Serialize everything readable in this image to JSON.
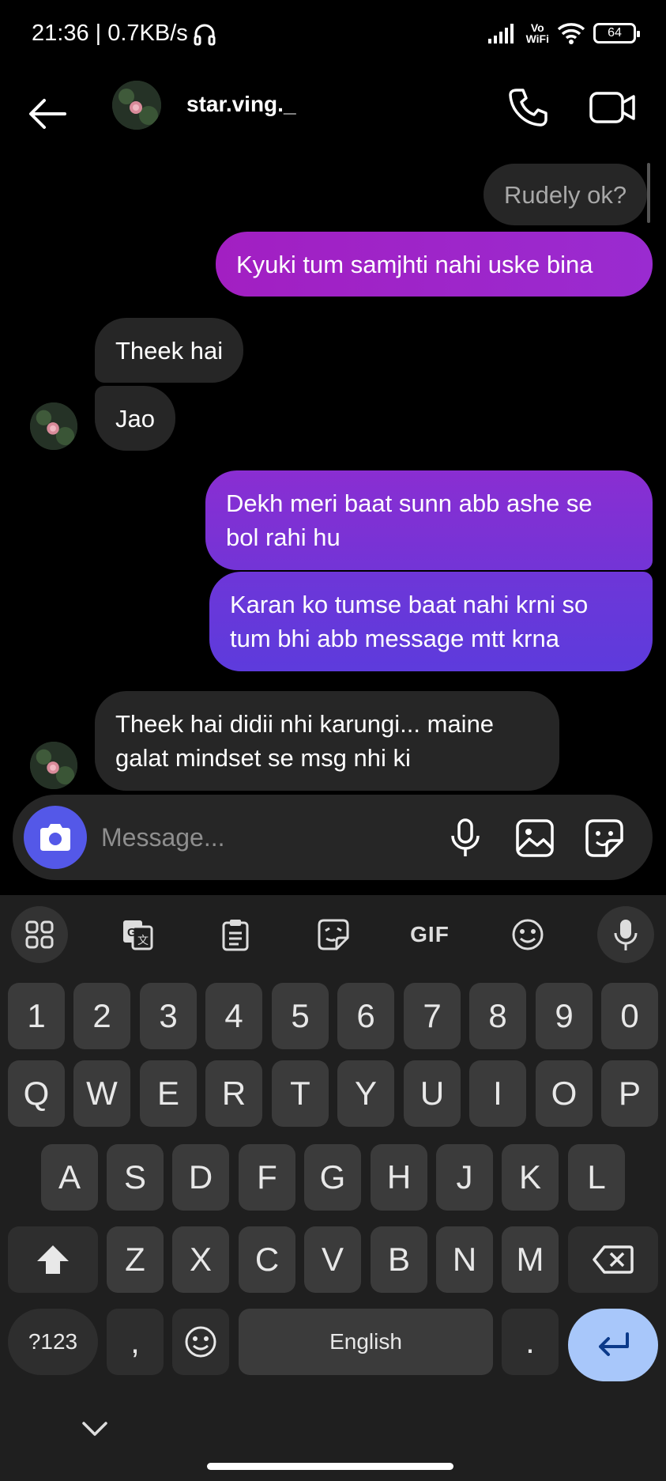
{
  "status": {
    "time_speed": "21:36 | 0.7KB/s",
    "vowifi_line1": "Vo",
    "vowifi_line2": "WiFi",
    "battery": "64"
  },
  "header": {
    "username": "star.ving._"
  },
  "messages": [
    {
      "from": "them",
      "text": "Rudely ok?"
    },
    {
      "from": "me",
      "text": "Kyuki tum samjhti nahi uske bina"
    },
    {
      "from": "them",
      "text": "Theek hai"
    },
    {
      "from": "them",
      "text": "Jao"
    },
    {
      "from": "me",
      "text_lines": [
        "Dekh meri baat sunn abb ashe se",
        "bol rahi hu"
      ]
    },
    {
      "from": "me",
      "text_lines": [
        "Karan ko tumse baat nahi krni so",
        "tum bhi abb message mtt krna"
      ]
    },
    {
      "from": "them",
      "text_lines": [
        "Theek hai didii nhi karungi... maine",
        "galat mindset se msg nhi ki"
      ]
    }
  ],
  "composer": {
    "placeholder": "Message..."
  },
  "keyboard": {
    "toolbar": {
      "gif_label": "GIF"
    },
    "rows": {
      "numbers": [
        "1",
        "2",
        "3",
        "4",
        "5",
        "6",
        "7",
        "8",
        "9",
        "0"
      ],
      "row1": [
        "Q",
        "W",
        "E",
        "R",
        "T",
        "Y",
        "U",
        "I",
        "O",
        "P"
      ],
      "row2": [
        "A",
        "S",
        "D",
        "F",
        "G",
        "H",
        "J",
        "K",
        "L"
      ],
      "row3": [
        "Z",
        "X",
        "C",
        "V",
        "B",
        "N",
        "M"
      ]
    },
    "symbols_key": "?123",
    "comma_key": ",",
    "space_label": "English",
    "period_key": "."
  },
  "colors": {
    "accent_blue": "#5458e8",
    "bubble_gradient_top": "#a626c8",
    "bubble_gradient_bottom": "#6437d8",
    "enter_key": "#a8c7fa"
  }
}
